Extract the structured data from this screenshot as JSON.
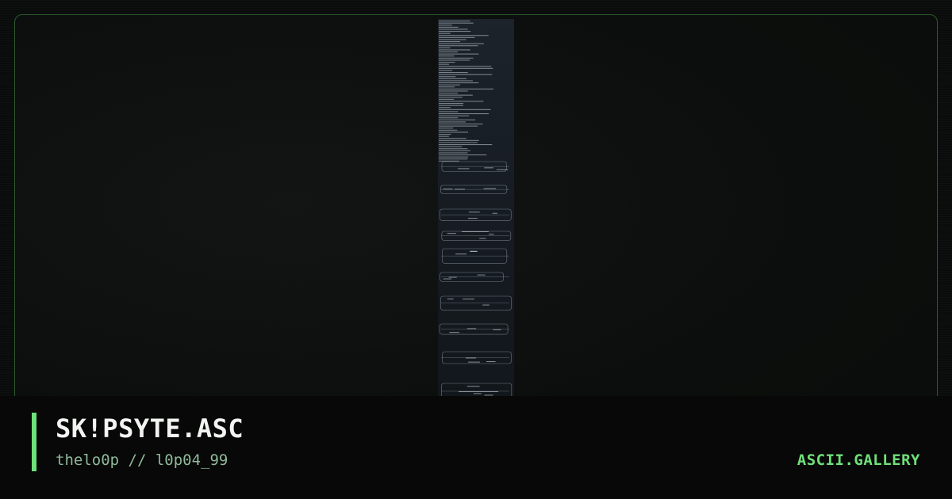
{
  "card": {
    "title": "SK!PSYTE.ASC",
    "subtitle": "thelo0p // l0p04_99",
    "brand": "ASCII.GALLERY"
  },
  "colors": {
    "accent": "#6fe07a",
    "frame_border": "#2c5a2c",
    "background": "#0a0c0b",
    "art_panel": "#1a2128"
  }
}
